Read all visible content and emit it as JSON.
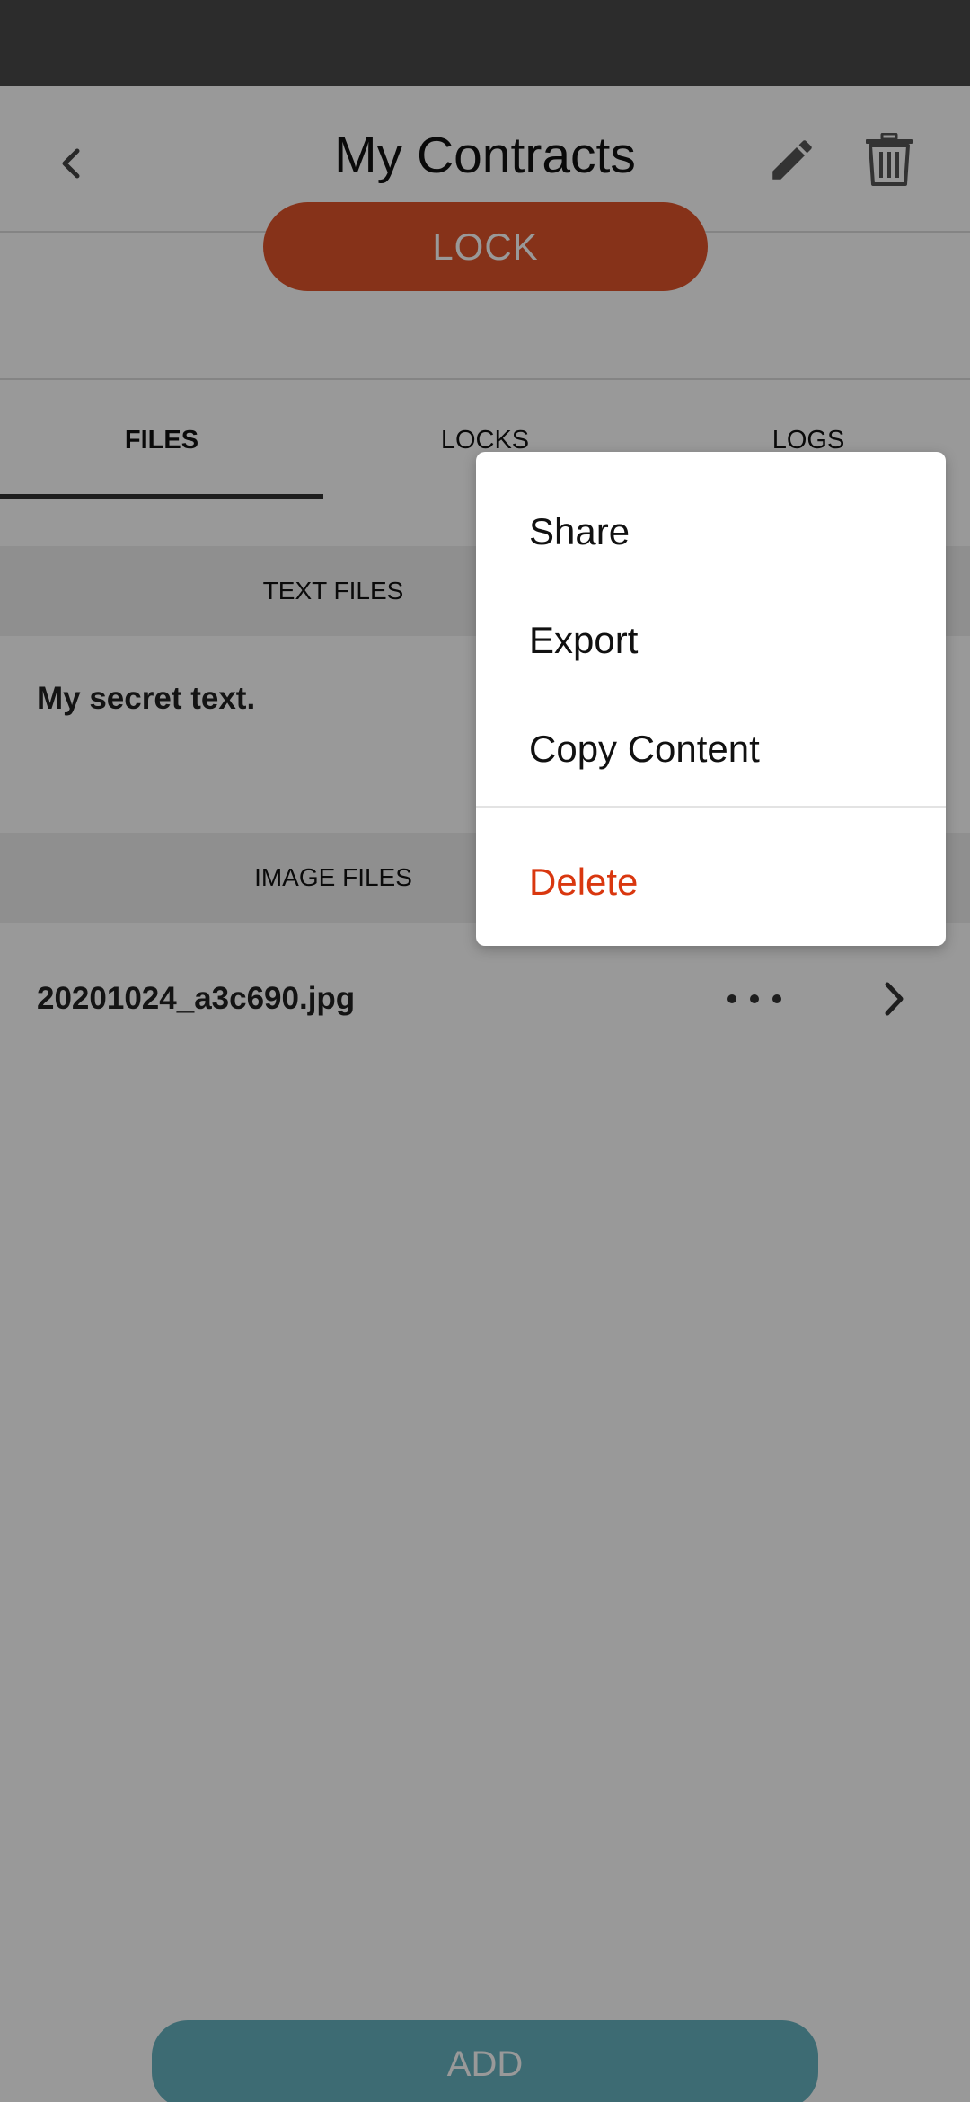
{
  "header": {
    "title": "My Contracts",
    "back_icon": "chevron-left-icon",
    "edit_icon": "pencil-icon",
    "delete_icon": "trash-icon"
  },
  "lock_button": {
    "label": "LOCK",
    "color": "#e0542a"
  },
  "tabs": [
    {
      "label": "FILES",
      "active": true
    },
    {
      "label": "LOCKS",
      "active": false
    },
    {
      "label": "LOGS",
      "active": false
    }
  ],
  "sections": {
    "text_files": {
      "header": "TEXT FILES",
      "items": [
        {
          "name": "My secret text."
        }
      ]
    },
    "image_files": {
      "header": "IMAGE FILES",
      "items": [
        {
          "name": "20201024_a3c690.jpg"
        }
      ]
    }
  },
  "add_button": {
    "label": "ADD",
    "color": "#66b3c0"
  },
  "context_menu": {
    "items": [
      {
        "label": "Share"
      },
      {
        "label": "Export"
      },
      {
        "label": "Copy Content"
      },
      {
        "label": "Delete",
        "color": "#d9370f"
      }
    ]
  }
}
